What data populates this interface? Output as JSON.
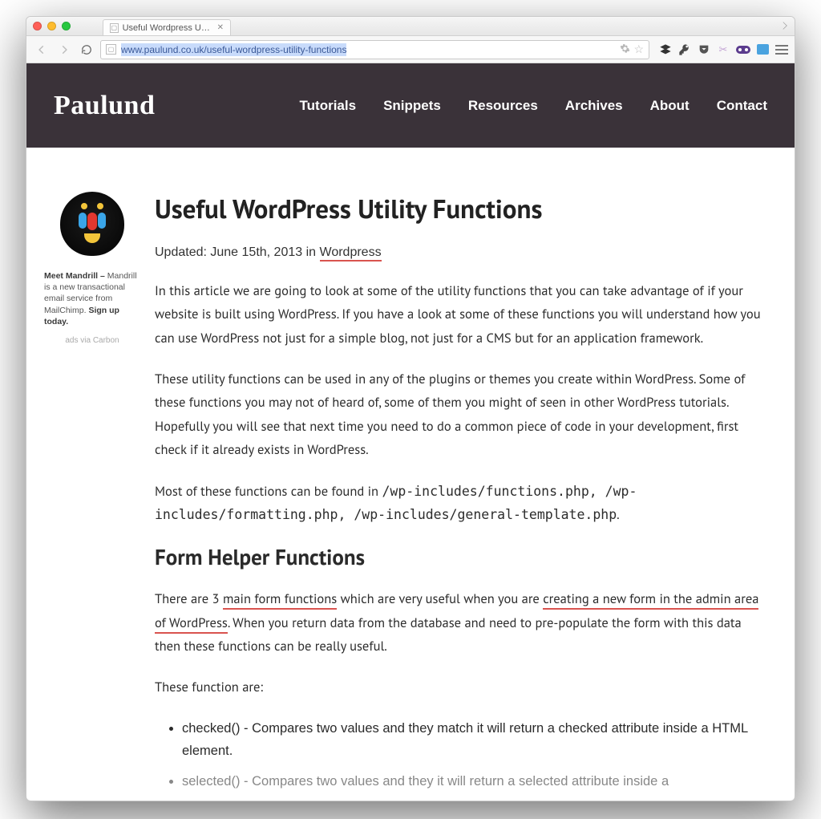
{
  "browser": {
    "tab_title": "Useful Wordpress Utility Fu",
    "url_domain": "www.paulund.co.uk",
    "url_path": "/useful-wordpress-utility-functions"
  },
  "site": {
    "logo": "Paulund",
    "nav": [
      "Tutorials",
      "Snippets",
      "Resources",
      "Archives",
      "About",
      "Contact"
    ]
  },
  "ad": {
    "text_prefix": "Meet Mandrill – ",
    "text_body": "Mandrill is a new transactional email service from MailChimp.",
    "cta": "Sign up today.",
    "via": "ads via Carbon"
  },
  "article": {
    "title": "Useful WordPress Utility Functions",
    "meta_prefix": "Updated: June 15th, 2013 in ",
    "meta_category": "Wordpress",
    "p1": "In this article we are going to look at some of the utility functions that you can take advantage of if your website is built using WordPress. If you have a look at some of these functions you will understand how you can use WordPress not just for a simple blog, not just for a CMS but for an application framework.",
    "p2": "These utility functions can be used in any of the plugins or themes you create within WordPress. Some of these functions you may not of heard of, some of them you might of seen in other WordPress tutorials. Hopefully you will see that next time you need to do a common piece of code in your development, first check if it already exists in WordPress.",
    "p3_a": "Most of these functions can be found in ",
    "p3_paths": "/wp-includes/functions.php, /wp-includes/formatting.php, /wp-includes/general-template.php",
    "p3_b": ".",
    "h2": "Form Helper Functions",
    "p4_a": "There are 3 ",
    "p4_link1": "main form functions",
    "p4_b": " which are very useful when you are ",
    "p4_link2": "creating a new form in the admin area of WordPress",
    "p4_c": ". When you return data from the database and need to pre-populate the form with this data then these functions can be really useful.",
    "p5": "These function are:",
    "li1": "checked() - Compares two values and they match it will return a checked attribute inside a HTML element.",
    "li2_cut": "selected() - Compares two values and they it will return a selected attribute inside a"
  }
}
